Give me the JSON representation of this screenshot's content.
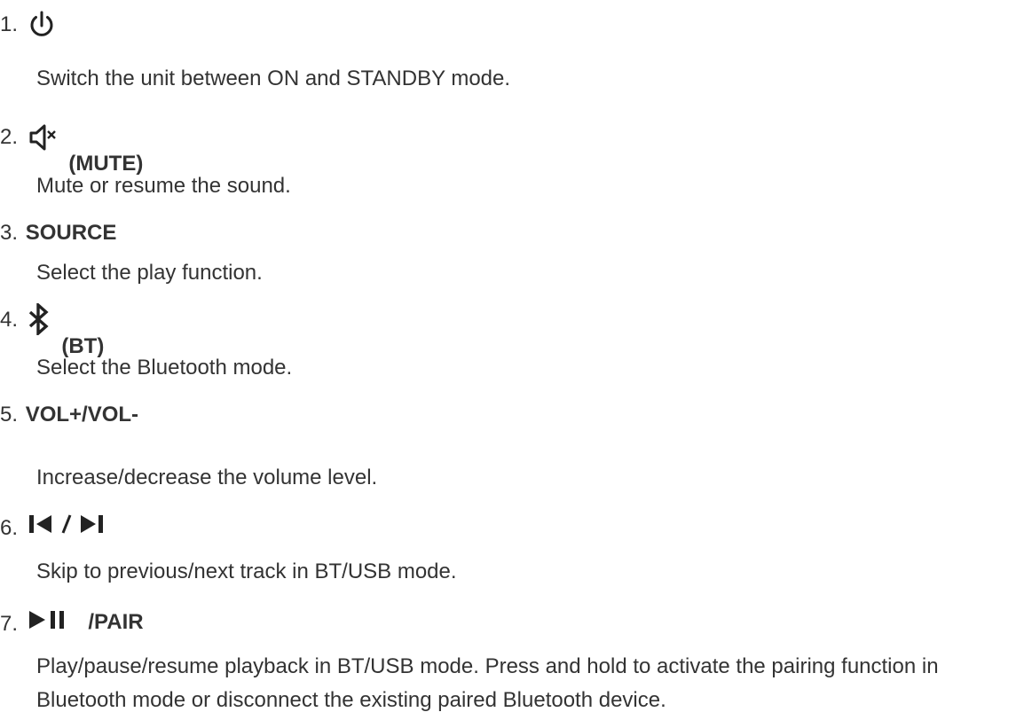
{
  "items": [
    {
      "number": "1.",
      "icon": "power-icon",
      "label": "",
      "description": "Switch the unit between ON and STANDBY mode."
    },
    {
      "number": "2.",
      "icon": "speaker-mute-icon",
      "label": "(MUTE)",
      "description": "Mute or resume the sound."
    },
    {
      "number": "3.",
      "icon": "",
      "label": "SOURCE",
      "description": "Select the play function."
    },
    {
      "number": "4.",
      "icon": "bluetooth-icon",
      "label": "(BT)",
      "description": "Select the Bluetooth mode."
    },
    {
      "number": "5.",
      "icon": "",
      "label": "VOL+/VOL-",
      "description": "Increase/decrease the volume level."
    },
    {
      "number": "6.",
      "icon": "skip-previous-next-icon",
      "label": "",
      "description": "Skip to previous/next track in BT/USB mode."
    },
    {
      "number": "7.",
      "icon": "play-pause-icon",
      "label": "/PAIR",
      "description": "Play/pause/resume playback in BT/USB mode. Press and hold to activate the pairing function in Bluetooth mode or disconnect the existing paired Bluetooth device."
    }
  ],
  "colors": {
    "text": "#333333",
    "icon": "#222222",
    "background": "#ffffff"
  }
}
